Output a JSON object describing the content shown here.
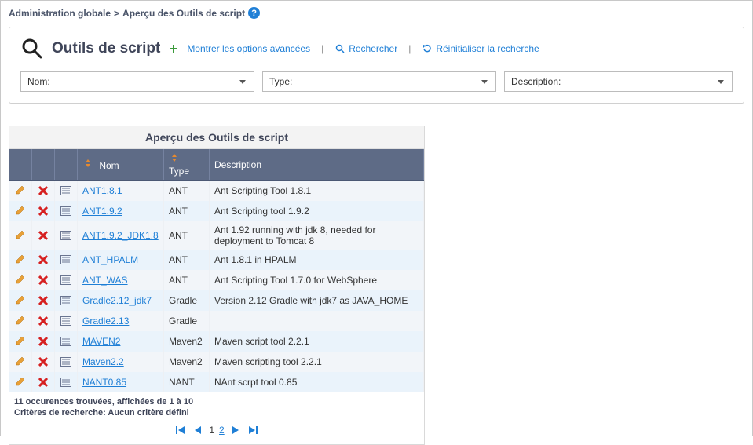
{
  "breadcrumb": {
    "part1": "Administration globale",
    "sep": ">",
    "part2": "Aperçu des Outils de script"
  },
  "panel": {
    "title": "Outils de script",
    "advanced_link": "Montrer les options avancées",
    "search_link": "Rechercher",
    "reset_link": "Réinitialiser la recherche"
  },
  "filters": {
    "name_label": "Nom:",
    "type_label": "Type:",
    "desc_label": "Description:"
  },
  "table": {
    "title": "Aperçu des Outils de script",
    "columns": {
      "name": "Nom",
      "type": "Type",
      "desc": "Description"
    },
    "rows": [
      {
        "name": "ANT1.8.1",
        "type": "ANT",
        "desc": "Ant Scripting Tool 1.8.1"
      },
      {
        "name": "ANT1.9.2",
        "type": "ANT",
        "desc": "Ant Scripting tool 1.9.2"
      },
      {
        "name": "ANT1.9.2_JDK1.8",
        "type": "ANT",
        "desc": "Ant 1.92 running with jdk 8, needed for deployment to Tomcat 8"
      },
      {
        "name": "ANT_HPALM",
        "type": "ANT",
        "desc": "Ant 1.8.1 in HPALM"
      },
      {
        "name": "ANT_WAS",
        "type": "ANT",
        "desc": "Ant Scripting Tool 1.7.0 for WebSphere"
      },
      {
        "name": "Gradle2.12_jdk7",
        "type": "Gradle",
        "desc": "Version 2.12 Gradle with jdk7 as JAVA_HOME"
      },
      {
        "name": "Gradle2.13",
        "type": "Gradle",
        "desc": ""
      },
      {
        "name": "MAVEN2",
        "type": "Maven2",
        "desc": "Maven script tool 2.2.1"
      },
      {
        "name": "Maven2.2",
        "type": "Maven2",
        "desc": "Maven scripting tool 2.2.1"
      },
      {
        "name": "NANT0.85",
        "type": "NANT",
        "desc": "NAnt scrpt tool 0.85"
      }
    ]
  },
  "footer": {
    "count_line": "11 occurences trouvées, affichées de 1 à 10",
    "criteria_line": "Critères de recherche: Aucun critère défini"
  },
  "pager": {
    "page1": "1",
    "page2": "2"
  }
}
